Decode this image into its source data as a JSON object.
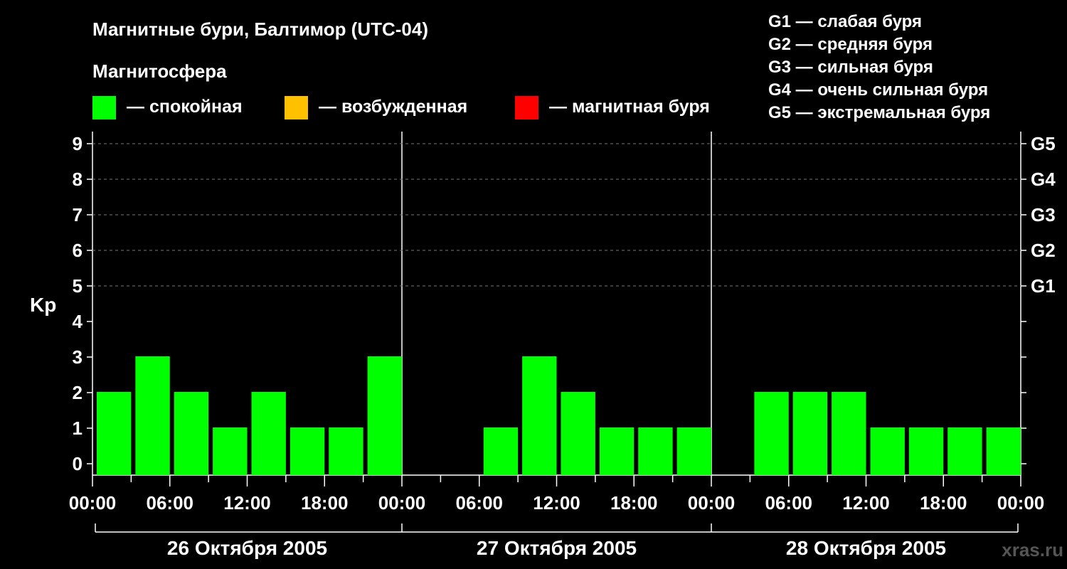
{
  "chart_data": {
    "type": "bar",
    "title": "Магнитные бури, Балтимор (UTC-04)",
    "legend": {
      "title": "Магнитосфера",
      "items": [
        {
          "label": "— спокойная",
          "color": "#00ff00"
        },
        {
          "label": "— возбужденная",
          "color": "#ffc000"
        },
        {
          "label": "— магнитная буря",
          "color": "#ff0000"
        }
      ]
    },
    "g_scale": [
      "G1 — слабая буря",
      "G2 — средняя буря",
      "G3 — сильная буря",
      "G4 — очень сильная буря",
      "G5 — экстремальная буря"
    ],
    "ylabel": "Kp",
    "ylim": [
      0,
      9
    ],
    "yticks": [
      "0",
      "1",
      "2",
      "3",
      "4",
      "5",
      "6",
      "7",
      "8",
      "9"
    ],
    "right_ticks": [
      {
        "kp": 5,
        "label": "G1"
      },
      {
        "kp": 6,
        "label": "G2"
      },
      {
        "kp": 7,
        "label": "G3"
      },
      {
        "kp": 8,
        "label": "G4"
      },
      {
        "kp": 9,
        "label": "G5"
      }
    ],
    "x_tick_labels": [
      "00:00",
      "06:00",
      "12:00",
      "18:00",
      "00:00",
      "06:00",
      "12:00",
      "18:00",
      "00:00",
      "06:00",
      "12:00",
      "18:00",
      "00:00"
    ],
    "days": [
      "26 Октября 2005",
      "27 Октября 2005",
      "28 Октября 2005"
    ],
    "interval_hours": 3,
    "values": [
      2,
      3,
      2,
      1,
      2,
      1,
      1,
      3,
      0,
      0,
      1,
      3,
      2,
      1,
      1,
      1,
      0,
      2,
      2,
      2,
      1,
      1,
      1,
      1
    ],
    "bar_color": "#00ff00",
    "watermark": "xras.ru"
  }
}
